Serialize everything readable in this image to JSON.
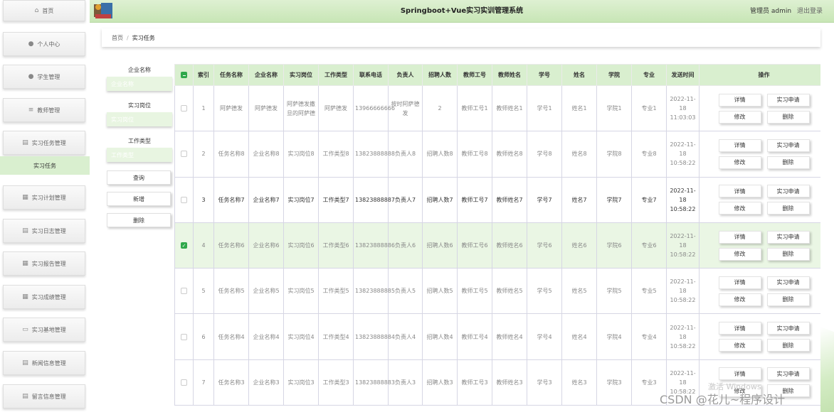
{
  "header": {
    "title": "Springboot+Vue实习实训管理系统",
    "user": "管理员 admin",
    "logout": "退出登录"
  },
  "sidebar": {
    "items": [
      {
        "label": "首页",
        "icon": "home-icon"
      },
      {
        "label": "个人中心",
        "icon": "user-icon"
      },
      {
        "label": "学生管理",
        "icon": "student-icon"
      },
      {
        "label": "教师管理",
        "icon": "list-icon"
      },
      {
        "label": "实习任务管理",
        "icon": "document-icon"
      },
      {
        "label": "实习计划管理",
        "icon": "grid-icon"
      },
      {
        "label": "实习日志管理",
        "icon": "document-icon"
      },
      {
        "label": "实习报告管理",
        "icon": "grid-icon"
      },
      {
        "label": "实习成绩管理",
        "icon": "grid-icon"
      },
      {
        "label": "实习基地管理",
        "icon": "monitor-icon"
      },
      {
        "label": "新闻信息管理",
        "icon": "document-icon"
      },
      {
        "label": "留言信息管理",
        "icon": "document-icon"
      }
    ],
    "active_sub": "实习任务"
  },
  "breadcrumb": {
    "home": "首页",
    "sep": "/",
    "current": "实习任务"
  },
  "search": {
    "fields": [
      {
        "label": "企业名称",
        "placeholder": "企业名称"
      },
      {
        "label": "实习岗位",
        "placeholder": "实习岗位"
      },
      {
        "label": "工作类型",
        "placeholder": "工作类型"
      }
    ],
    "query_btn": "查询",
    "add_btn": "新增",
    "delete_btn": "删除"
  },
  "table": {
    "headers": [
      "索引",
      "任务名称",
      "企业名称",
      "实习岗位",
      "工作类型",
      "联系电话",
      "负责人",
      "招聘人数",
      "教师工号",
      "教师姓名",
      "学号",
      "姓名",
      "学院",
      "专业",
      "发送时间",
      "操作"
    ],
    "rows": [
      {
        "index": "1",
        "task": "阿萨德发",
        "company": "阿萨德发",
        "post": "阿萨德发撒旦的阿萨德",
        "type": "阿萨德发",
        "phone": "13966666666",
        "leader": "按时阿萨德发",
        "count": "2",
        "teacher_no": "教师工号1",
        "teacher_name": "教师姓名1",
        "sno": "学号1",
        "sname": "姓名1",
        "college": "学院1",
        "major": "专业1",
        "time": "2022-11-18 11:03:03",
        "checked": false,
        "bold": false
      },
      {
        "index": "2",
        "task": "任务名称8",
        "company": "企业名称8",
        "post": "实习岗位8",
        "type": "工作类型8",
        "phone": "13823888888",
        "leader": "负责人8",
        "count": "招聘人数8",
        "teacher_no": "教师工号8",
        "teacher_name": "教师姓名8",
        "sno": "学号8",
        "sname": "姓名8",
        "college": "学院8",
        "major": "专业8",
        "time": "2022-11-18 10:58:22",
        "checked": false,
        "bold": false
      },
      {
        "index": "3",
        "task": "任务名称7",
        "company": "企业名称7",
        "post": "实习岗位7",
        "type": "工作类型7",
        "phone": "13823888887",
        "leader": "负责人7",
        "count": "招聘人数7",
        "teacher_no": "教师工号7",
        "teacher_name": "教师姓名7",
        "sno": "学号7",
        "sname": "姓名7",
        "college": "学院7",
        "major": "专业7",
        "time": "2022-11-18 10:58:22",
        "checked": false,
        "bold": true
      },
      {
        "index": "4",
        "task": "任务名称6",
        "company": "企业名称6",
        "post": "实习岗位6",
        "type": "工作类型6",
        "phone": "13823888886",
        "leader": "负责人6",
        "count": "招聘人数6",
        "teacher_no": "教师工号6",
        "teacher_name": "教师姓名6",
        "sno": "学号6",
        "sname": "姓名6",
        "college": "学院6",
        "major": "专业6",
        "time": "2022-11-18 10:58:22",
        "checked": true,
        "bold": false
      },
      {
        "index": "5",
        "task": "任务名称5",
        "company": "企业名称5",
        "post": "实习岗位5",
        "type": "工作类型5",
        "phone": "13823888885",
        "leader": "负责人5",
        "count": "招聘人数5",
        "teacher_no": "教师工号5",
        "teacher_name": "教师姓名5",
        "sno": "学号5",
        "sname": "姓名5",
        "college": "学院5",
        "major": "专业5",
        "time": "2022-11-18 10:58:22",
        "checked": false,
        "bold": false
      },
      {
        "index": "6",
        "task": "任务名称4",
        "company": "企业名称4",
        "post": "实习岗位4",
        "type": "工作类型4",
        "phone": "13823888884",
        "leader": "负责人4",
        "count": "招聘人数4",
        "teacher_no": "教师工号4",
        "teacher_name": "教师姓名4",
        "sno": "学号4",
        "sname": "姓名4",
        "college": "学院4",
        "major": "专业4",
        "time": "2022-11-18 10:58:22",
        "checked": false,
        "bold": false
      },
      {
        "index": "7",
        "task": "任务名称3",
        "company": "企业名称3",
        "post": "实习岗位3",
        "type": "工作类型3",
        "phone": "13823888883",
        "leader": "负责人3",
        "count": "招聘人数3",
        "teacher_no": "教师工号3",
        "teacher_name": "教师姓名3",
        "sno": "学号3",
        "sname": "姓名3",
        "college": "学院3",
        "major": "专业3",
        "time": "2022-11-18 10:58:22",
        "checked": false,
        "bold": false
      }
    ],
    "ops": {
      "detail": "详情",
      "apply": "实习申请",
      "edit": "修改",
      "delete": "删除"
    }
  },
  "watermark": {
    "activate": "激活 Windows",
    "csdn": "CSDN @花儿~程序设计"
  },
  "colors": {
    "accent_green": "#d9efcf",
    "checkbox_green": "#2fa84a"
  }
}
